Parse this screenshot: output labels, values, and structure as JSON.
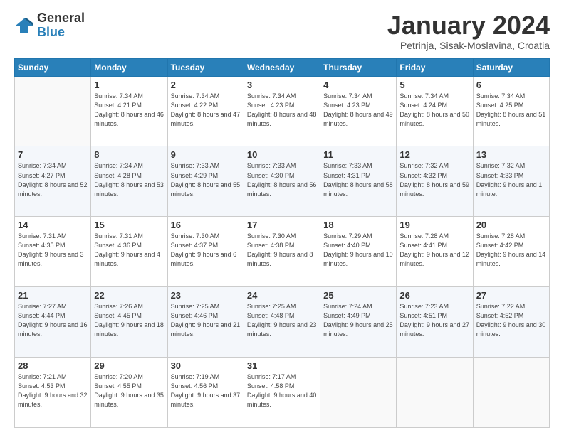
{
  "header": {
    "logo": {
      "general": "General",
      "blue": "Blue"
    },
    "title": "January 2024",
    "location": "Petrinja, Sisak-Moslavina, Croatia"
  },
  "columns": [
    "Sunday",
    "Monday",
    "Tuesday",
    "Wednesday",
    "Thursday",
    "Friday",
    "Saturday"
  ],
  "weeks": [
    [
      {
        "day": "",
        "sunrise": "",
        "sunset": "",
        "daylight": ""
      },
      {
        "day": "1",
        "sunrise": "Sunrise: 7:34 AM",
        "sunset": "Sunset: 4:21 PM",
        "daylight": "Daylight: 8 hours and 46 minutes."
      },
      {
        "day": "2",
        "sunrise": "Sunrise: 7:34 AM",
        "sunset": "Sunset: 4:22 PM",
        "daylight": "Daylight: 8 hours and 47 minutes."
      },
      {
        "day": "3",
        "sunrise": "Sunrise: 7:34 AM",
        "sunset": "Sunset: 4:23 PM",
        "daylight": "Daylight: 8 hours and 48 minutes."
      },
      {
        "day": "4",
        "sunrise": "Sunrise: 7:34 AM",
        "sunset": "Sunset: 4:23 PM",
        "daylight": "Daylight: 8 hours and 49 minutes."
      },
      {
        "day": "5",
        "sunrise": "Sunrise: 7:34 AM",
        "sunset": "Sunset: 4:24 PM",
        "daylight": "Daylight: 8 hours and 50 minutes."
      },
      {
        "day": "6",
        "sunrise": "Sunrise: 7:34 AM",
        "sunset": "Sunset: 4:25 PM",
        "daylight": "Daylight: 8 hours and 51 minutes."
      }
    ],
    [
      {
        "day": "7",
        "sunrise": "Sunrise: 7:34 AM",
        "sunset": "Sunset: 4:27 PM",
        "daylight": "Daylight: 8 hours and 52 minutes."
      },
      {
        "day": "8",
        "sunrise": "Sunrise: 7:34 AM",
        "sunset": "Sunset: 4:28 PM",
        "daylight": "Daylight: 8 hours and 53 minutes."
      },
      {
        "day": "9",
        "sunrise": "Sunrise: 7:33 AM",
        "sunset": "Sunset: 4:29 PM",
        "daylight": "Daylight: 8 hours and 55 minutes."
      },
      {
        "day": "10",
        "sunrise": "Sunrise: 7:33 AM",
        "sunset": "Sunset: 4:30 PM",
        "daylight": "Daylight: 8 hours and 56 minutes."
      },
      {
        "day": "11",
        "sunrise": "Sunrise: 7:33 AM",
        "sunset": "Sunset: 4:31 PM",
        "daylight": "Daylight: 8 hours and 58 minutes."
      },
      {
        "day": "12",
        "sunrise": "Sunrise: 7:32 AM",
        "sunset": "Sunset: 4:32 PM",
        "daylight": "Daylight: 8 hours and 59 minutes."
      },
      {
        "day": "13",
        "sunrise": "Sunrise: 7:32 AM",
        "sunset": "Sunset: 4:33 PM",
        "daylight": "Daylight: 9 hours and 1 minute."
      }
    ],
    [
      {
        "day": "14",
        "sunrise": "Sunrise: 7:31 AM",
        "sunset": "Sunset: 4:35 PM",
        "daylight": "Daylight: 9 hours and 3 minutes."
      },
      {
        "day": "15",
        "sunrise": "Sunrise: 7:31 AM",
        "sunset": "Sunset: 4:36 PM",
        "daylight": "Daylight: 9 hours and 4 minutes."
      },
      {
        "day": "16",
        "sunrise": "Sunrise: 7:30 AM",
        "sunset": "Sunset: 4:37 PM",
        "daylight": "Daylight: 9 hours and 6 minutes."
      },
      {
        "day": "17",
        "sunrise": "Sunrise: 7:30 AM",
        "sunset": "Sunset: 4:38 PM",
        "daylight": "Daylight: 9 hours and 8 minutes."
      },
      {
        "day": "18",
        "sunrise": "Sunrise: 7:29 AM",
        "sunset": "Sunset: 4:40 PM",
        "daylight": "Daylight: 9 hours and 10 minutes."
      },
      {
        "day": "19",
        "sunrise": "Sunrise: 7:28 AM",
        "sunset": "Sunset: 4:41 PM",
        "daylight": "Daylight: 9 hours and 12 minutes."
      },
      {
        "day": "20",
        "sunrise": "Sunrise: 7:28 AM",
        "sunset": "Sunset: 4:42 PM",
        "daylight": "Daylight: 9 hours and 14 minutes."
      }
    ],
    [
      {
        "day": "21",
        "sunrise": "Sunrise: 7:27 AM",
        "sunset": "Sunset: 4:44 PM",
        "daylight": "Daylight: 9 hours and 16 minutes."
      },
      {
        "day": "22",
        "sunrise": "Sunrise: 7:26 AM",
        "sunset": "Sunset: 4:45 PM",
        "daylight": "Daylight: 9 hours and 18 minutes."
      },
      {
        "day": "23",
        "sunrise": "Sunrise: 7:25 AM",
        "sunset": "Sunset: 4:46 PM",
        "daylight": "Daylight: 9 hours and 21 minutes."
      },
      {
        "day": "24",
        "sunrise": "Sunrise: 7:25 AM",
        "sunset": "Sunset: 4:48 PM",
        "daylight": "Daylight: 9 hours and 23 minutes."
      },
      {
        "day": "25",
        "sunrise": "Sunrise: 7:24 AM",
        "sunset": "Sunset: 4:49 PM",
        "daylight": "Daylight: 9 hours and 25 minutes."
      },
      {
        "day": "26",
        "sunrise": "Sunrise: 7:23 AM",
        "sunset": "Sunset: 4:51 PM",
        "daylight": "Daylight: 9 hours and 27 minutes."
      },
      {
        "day": "27",
        "sunrise": "Sunrise: 7:22 AM",
        "sunset": "Sunset: 4:52 PM",
        "daylight": "Daylight: 9 hours and 30 minutes."
      }
    ],
    [
      {
        "day": "28",
        "sunrise": "Sunrise: 7:21 AM",
        "sunset": "Sunset: 4:53 PM",
        "daylight": "Daylight: 9 hours and 32 minutes."
      },
      {
        "day": "29",
        "sunrise": "Sunrise: 7:20 AM",
        "sunset": "Sunset: 4:55 PM",
        "daylight": "Daylight: 9 hours and 35 minutes."
      },
      {
        "day": "30",
        "sunrise": "Sunrise: 7:19 AM",
        "sunset": "Sunset: 4:56 PM",
        "daylight": "Daylight: 9 hours and 37 minutes."
      },
      {
        "day": "31",
        "sunrise": "Sunrise: 7:17 AM",
        "sunset": "Sunset: 4:58 PM",
        "daylight": "Daylight: 9 hours and 40 minutes."
      },
      {
        "day": "",
        "sunrise": "",
        "sunset": "",
        "daylight": ""
      },
      {
        "day": "",
        "sunrise": "",
        "sunset": "",
        "daylight": ""
      },
      {
        "day": "",
        "sunrise": "",
        "sunset": "",
        "daylight": ""
      }
    ]
  ]
}
